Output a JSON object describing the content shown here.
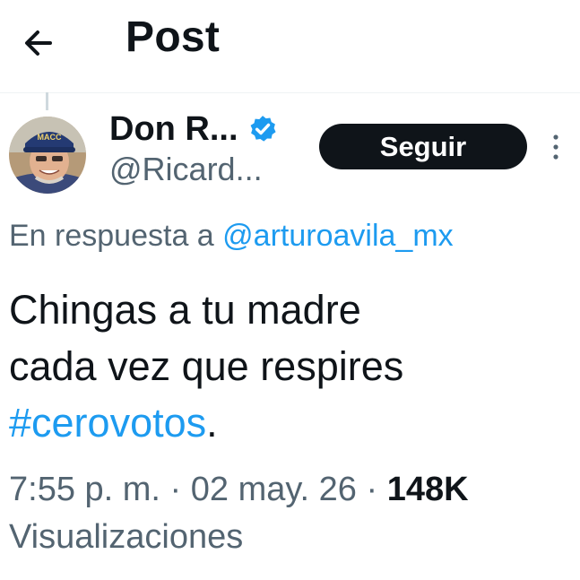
{
  "header": {
    "title": "Post",
    "back_icon": "arrow-left-icon"
  },
  "author": {
    "display_name": "Don R...",
    "handle": "@Ricard...",
    "verified": true,
    "verified_icon": "verified-badge-icon",
    "verified_color": "#1d9bf0"
  },
  "actions": {
    "follow_label": "Seguir",
    "more_icon": "more-vertical-icon"
  },
  "reply": {
    "prefix": "En respuesta a",
    "mention": "@arturoavila_mx"
  },
  "tweet": {
    "line1": "Chingas a tu madre",
    "line2": "cada vez que respires",
    "hashtag": "#cerovotos",
    "hashtag_suffix": "."
  },
  "meta": {
    "time": "7:55 p. m.",
    "separator": "·",
    "date": "02 may. 26",
    "views_count": "148K",
    "views_label": "Visualizaciones"
  },
  "colors": {
    "accent": "#1d9bf0",
    "text_primary": "#0f1419",
    "text_secondary": "#536471",
    "button_bg": "#0f1419"
  }
}
